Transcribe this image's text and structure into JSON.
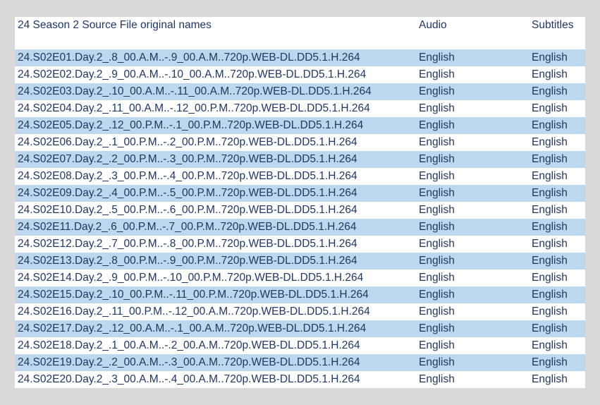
{
  "header": {
    "title": "24 Season 2 Source File original names",
    "audio": "Audio",
    "subtitles": "Subtitles"
  },
  "colors": {
    "page_background": "#d9d9d9",
    "sheet_background": "#ffffff",
    "band_fill": "#bdd7ee",
    "text": "#1f3864"
  },
  "rows": [
    {
      "name": "24.S02E01.Day.2_.8_00.A.M..-.9_00.A.M..720p.WEB-DL.DD5.1.H.264",
      "audio": "English",
      "subtitles": "English"
    },
    {
      "name": "24.S02E02.Day.2_.9_00.A.M..-.10_00.A.M..720p.WEB-DL.DD5.1.H.264",
      "audio": "English",
      "subtitles": "English"
    },
    {
      "name": "24.S02E03.Day.2_.10_00.A.M..-.11_00.A.M..720p.WEB-DL.DD5.1.H.264",
      "audio": "English",
      "subtitles": "English"
    },
    {
      "name": "24.S02E04.Day.2_.11_00.A.M..-.12_00.P.M..720p.WEB-DL.DD5.1.H.264",
      "audio": "English",
      "subtitles": "English"
    },
    {
      "name": "24.S02E05.Day.2_.12_00.P.M..-.1_00.P.M..720p.WEB-DL.DD5.1.H.264",
      "audio": "English",
      "subtitles": "English"
    },
    {
      "name": "24.S02E06.Day.2_.1_00.P.M..-.2_00.P.M..720p.WEB-DL.DD5.1.H.264",
      "audio": "English",
      "subtitles": "English"
    },
    {
      "name": "24.S02E07.Day.2_.2_00.P.M..-.3_00.P.M..720p.WEB-DL.DD5.1.H.264",
      "audio": "English",
      "subtitles": "English"
    },
    {
      "name": "24.S02E08.Day.2_.3_00.P.M..-.4_00.P.M..720p.WEB-DL.DD5.1.H.264",
      "audio": "English",
      "subtitles": "English"
    },
    {
      "name": "24.S02E09.Day.2_.4_00.P.M..-.5_00.P.M..720p.WEB-DL.DD5.1.H.264",
      "audio": "English",
      "subtitles": "English"
    },
    {
      "name": "24.S02E10.Day.2_.5_00.P.M..-.6_00.P.M..720p.WEB-DL.DD5.1.H.264",
      "audio": "English",
      "subtitles": "English"
    },
    {
      "name": "24.S02E11.Day.2_.6_00.P.M..-.7_00.P.M..720p.WEB-DL.DD5.1.H.264",
      "audio": "English",
      "subtitles": "English"
    },
    {
      "name": "24.S02E12.Day.2_.7_00.P.M..-.8_00.P.M..720p.WEB-DL.DD5.1.H.264",
      "audio": "English",
      "subtitles": "English"
    },
    {
      "name": "24.S02E13.Day.2_.8_00.P.M..-.9_00.P.M..720p.WEB-DL.DD5.1.H.264",
      "audio": "English",
      "subtitles": "English"
    },
    {
      "name": "24.S02E14.Day.2_.9_00.P.M..-.10_00.P.M..720p.WEB-DL.DD5.1.H.264",
      "audio": "English",
      "subtitles": "English"
    },
    {
      "name": "24.S02E15.Day.2_.10_00.P.M..-.11_00.P.M..720p.WEB-DL.DD5.1.H.264",
      "audio": "English",
      "subtitles": "English"
    },
    {
      "name": "24.S02E16.Day.2_.11_00.P.M..-.12_00.A.M..720p.WEB-DL.DD5.1.H.264",
      "audio": "English",
      "subtitles": "English"
    },
    {
      "name": "24.S02E17.Day.2_.12_00.A.M..-.1_00.A.M..720p.WEB-DL.DD5.1.H.264",
      "audio": "English",
      "subtitles": "English"
    },
    {
      "name": "24.S02E18.Day.2_.1_00.A.M..-.2_00.A.M..720p.WEB-DL.DD5.1.H.264",
      "audio": "English",
      "subtitles": "English"
    },
    {
      "name": "24.S02E19.Day.2_.2_00.A.M..-.3_00.A.M..720p.WEB-DL.DD5.1.H.264",
      "audio": "English",
      "subtitles": "English"
    },
    {
      "name": "24.S02E20.Day.2_.3_00.A.M..-.4_00.A.M..720p.WEB-DL.DD5.1.H.264",
      "audio": "English",
      "subtitles": "English"
    }
  ]
}
